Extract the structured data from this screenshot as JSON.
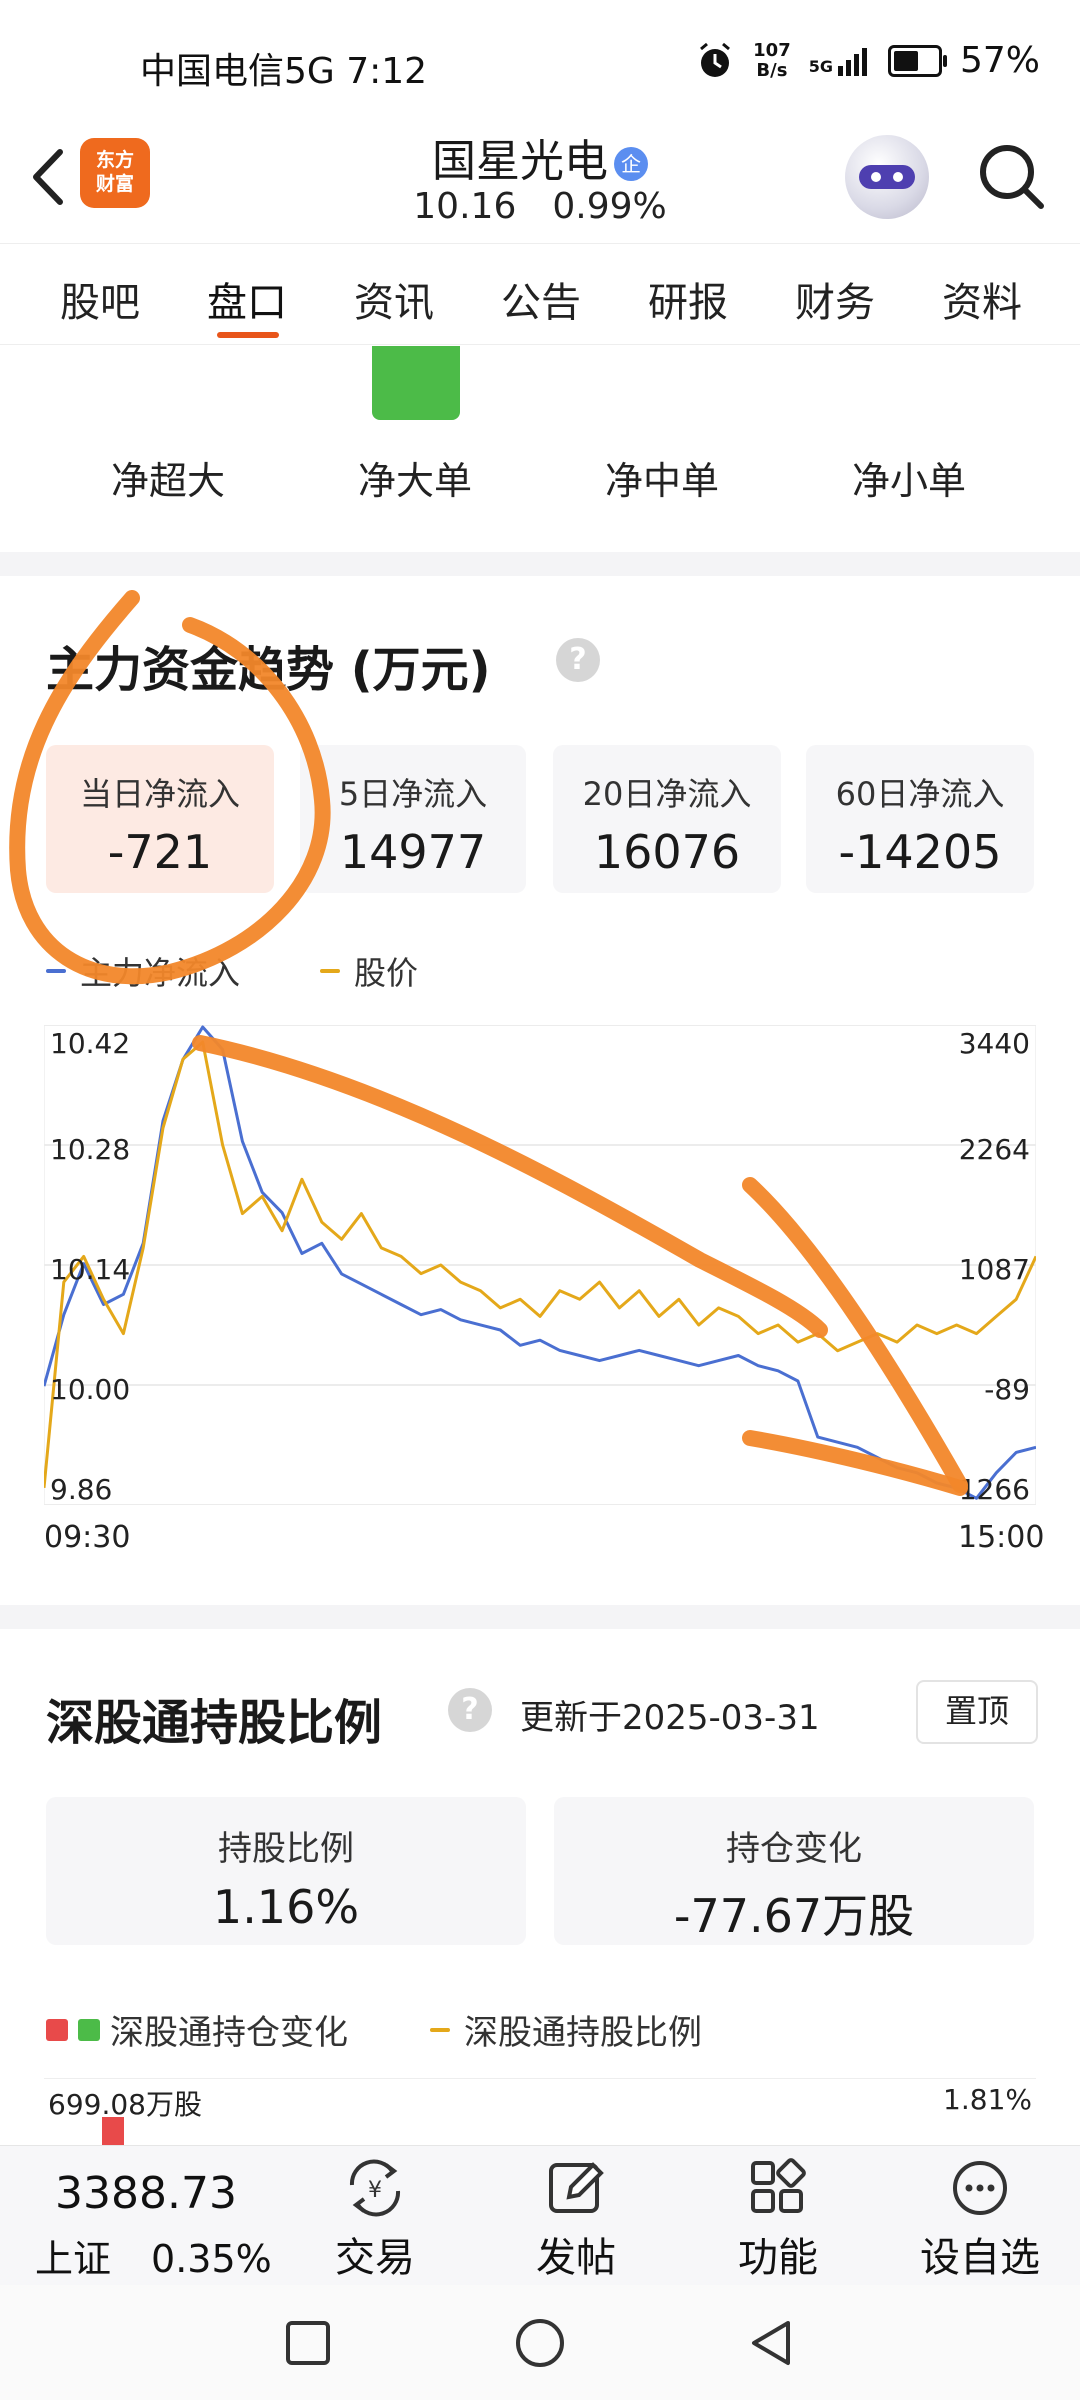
{
  "status_bar": {
    "carrier_time": "中国电信5G 7:12",
    "net_speed_value": "107",
    "net_speed_unit": "B/s",
    "signal": "5G",
    "battery": "57%",
    "battery_level": 0.57
  },
  "header": {
    "app_logo": "东方\n财富",
    "stock_name": "国星光电",
    "badge": "企",
    "price": "10.16",
    "change": "0.99%"
  },
  "tabs": [
    "股吧",
    "盘口",
    "资讯",
    "公告",
    "研报",
    "财务",
    "资料"
  ],
  "active_tab": "盘口",
  "flow_labels": [
    "净超大",
    "净大单",
    "净中单",
    "净小单"
  ],
  "capital_trend": {
    "title": "主力资金趋势 (万元)",
    "help": "?",
    "stats": [
      {
        "label": "当日净流入",
        "value": "-721"
      },
      {
        "label": "5日净流入",
        "value": "14977"
      },
      {
        "label": "20日净流入",
        "value": "16076"
      },
      {
        "label": "60日净流入",
        "value": "-14205"
      }
    ],
    "legend": [
      {
        "name": "主力净流入",
        "color": "#4a6fd1"
      },
      {
        "name": "股价",
        "color": "#e4a81a"
      }
    ]
  },
  "chart_data": {
    "type": "line",
    "x_labels": [
      "09:30",
      "15:00"
    ],
    "left_axis_ticks": [
      "10.42",
      "10.28",
      "10.14",
      "10.00",
      "9.86"
    ],
    "right_axis_ticks": [
      "3440",
      "2264",
      "1087",
      "-89",
      "1266"
    ],
    "ylim_price": [
      9.86,
      10.42
    ],
    "ylim_flow": [
      -1266,
      3440
    ],
    "grid": true,
    "series": [
      {
        "name": "主力净流入",
        "color": "#4a6fd1",
        "axis": "right",
        "values": [
          -100,
          600,
          1100,
          700,
          800,
          1300,
          2500,
          3100,
          3500,
          3200,
          2300,
          1800,
          1600,
          1200,
          1300,
          1000,
          900,
          800,
          700,
          600,
          650,
          550,
          500,
          450,
          300,
          350,
          250,
          200,
          150,
          200,
          250,
          200,
          150,
          100,
          150,
          200,
          100,
          50,
          -50,
          -600,
          -650,
          -700,
          -800,
          -900,
          -950,
          -1050,
          -1100,
          -1200,
          -950,
          -750,
          -700
        ]
      },
      {
        "name": "股价",
        "color": "#e4a81a",
        "axis": "left",
        "values": [
          9.88,
          10.12,
          10.15,
          10.1,
          10.06,
          10.16,
          10.3,
          10.38,
          10.4,
          10.28,
          10.2,
          10.22,
          10.18,
          10.24,
          10.19,
          10.17,
          10.2,
          10.16,
          10.15,
          10.13,
          10.14,
          10.12,
          10.11,
          10.09,
          10.1,
          10.08,
          10.11,
          10.1,
          10.12,
          10.09,
          10.11,
          10.08,
          10.1,
          10.07,
          10.09,
          10.08,
          10.06,
          10.07,
          10.05,
          10.06,
          10.04,
          10.05,
          10.06,
          10.05,
          10.07,
          10.06,
          10.07,
          10.06,
          10.08,
          10.1,
          10.15
        ]
      }
    ]
  },
  "hk_connect": {
    "title": "深股通持股比例",
    "help": "?",
    "updated": "更新于2025-03-31",
    "pin": "置顶",
    "stats": [
      {
        "label": "持股比例",
        "value": "1.16%"
      },
      {
        "label": "持仓变化",
        "value": "-77.67万股"
      }
    ],
    "legend_change": "深股通持仓变化",
    "legend_ratio": "深股通持股比例",
    "axis_left": "699.08万股",
    "axis_right": "1.81%",
    "colors": {
      "up": "#e84a4a",
      "down": "#4cbb48",
      "ratio": "#e4a81a"
    }
  },
  "bottom_nav": {
    "index_value": "3388.73",
    "index_name": "上证",
    "index_change": "0.35%",
    "items": [
      {
        "label": "交易",
        "icon": "trade-icon"
      },
      {
        "label": "发帖",
        "icon": "post-icon"
      },
      {
        "label": "功能",
        "icon": "grid-icon"
      },
      {
        "label": "设自选",
        "icon": "more-icon"
      }
    ]
  },
  "system_nav": [
    "recent-apps-icon",
    "home-icon",
    "back-icon"
  ],
  "annotation_color": "#f2872a"
}
